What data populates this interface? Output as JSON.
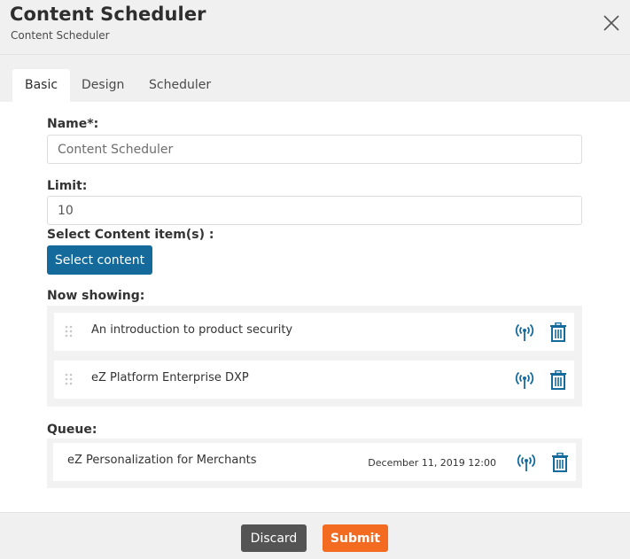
{
  "header": {
    "title": "Content Scheduler",
    "subtitle": "Content Scheduler",
    "close_icon": "close-icon"
  },
  "tabs": [
    {
      "label": "Basic",
      "active": true
    },
    {
      "label": "Design",
      "active": false
    },
    {
      "label": "Scheduler",
      "active": false
    }
  ],
  "form": {
    "name_label": "Name*:",
    "name_placeholder": "Content Scheduler",
    "limit_label": "Limit:",
    "limit_value": "10",
    "select_label": "Select Content item(s) :",
    "select_button": "Select content"
  },
  "now_showing": {
    "label": "Now showing:",
    "items": [
      {
        "title": "An introduction to product security"
      },
      {
        "title": "eZ Platform Enterprise DXP"
      }
    ]
  },
  "queue": {
    "label": "Queue:",
    "items": [
      {
        "title": "eZ Personalization for Merchants",
        "date": "December 11, 2019 12:00"
      }
    ]
  },
  "footer": {
    "discard_label": "Discard",
    "submit_label": "Submit"
  },
  "colors": {
    "primary": "#146b9b",
    "accent": "#f26b21",
    "discard": "#545454",
    "icon": "#146b9b"
  }
}
